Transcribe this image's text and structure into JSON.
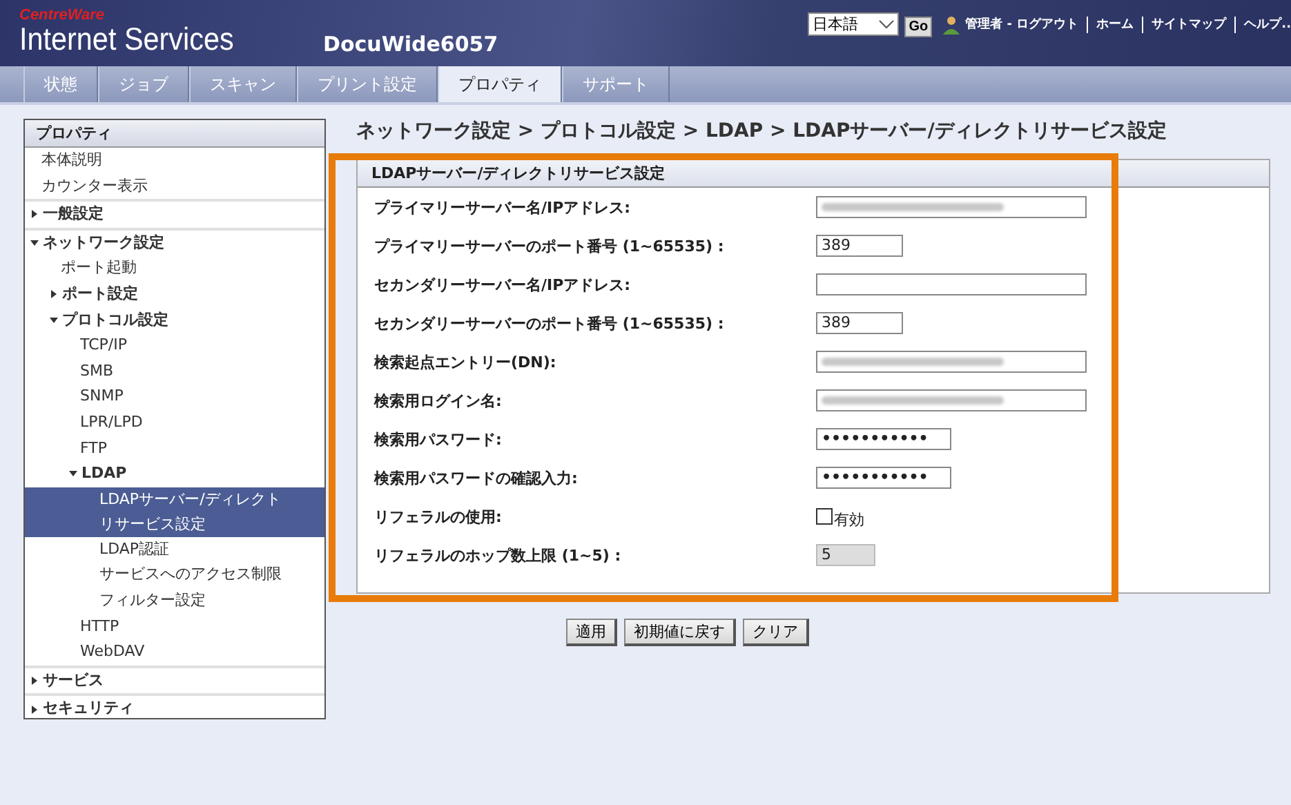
{
  "header": {
    "logo_top": "CentreWare",
    "logo_main": "Internet Services",
    "device": "DocuWide6057",
    "language": "日本語",
    "go": "Go",
    "user": "管理者 - ログアウト",
    "links": [
      "ホーム",
      "サイトマップ",
      "ヘルプ.."
    ]
  },
  "tabs": [
    {
      "label": "状態",
      "selected": false
    },
    {
      "label": "ジョブ",
      "selected": false
    },
    {
      "label": "スキャン",
      "selected": false
    },
    {
      "label": "プリント設定",
      "selected": false
    },
    {
      "label": "プロパティ",
      "selected": true
    },
    {
      "label": "サポート",
      "selected": false
    }
  ],
  "sidebar": {
    "title": "プロパティ",
    "items": [
      {
        "label": "本体説明",
        "selected": false
      },
      {
        "label": "カウンター表示",
        "selected": false
      },
      {
        "label": "一般設定",
        "selected": false,
        "expanded": false
      },
      {
        "label": "ネットワーク設定",
        "selected": false,
        "expanded": true,
        "children": [
          {
            "label": "ポート起動",
            "selected": false
          },
          {
            "label": "ポート設定",
            "selected": false,
            "expanded": false
          },
          {
            "label": "プロトコル設定",
            "selected": false,
            "expanded": true,
            "children": [
              {
                "label": "TCP/IP",
                "selected": false
              },
              {
                "label": "SMB",
                "selected": false
              },
              {
                "label": "SNMP",
                "selected": false
              },
              {
                "label": "LPR/LPD",
                "selected": false
              },
              {
                "label": "FTP",
                "selected": false
              },
              {
                "label": "LDAP",
                "selected": false,
                "expanded": true,
                "children": [
                  {
                    "label": "LDAPサーバー/ディレクトリサービス設定",
                    "selected": true
                  },
                  {
                    "label": "LDAP認証",
                    "selected": false
                  },
                  {
                    "label": "サービスへのアクセス制限",
                    "selected": false
                  },
                  {
                    "label": "フィルター設定",
                    "selected": false
                  }
                ]
              },
              {
                "label": "HTTP",
                "selected": false
              },
              {
                "label": "WebDAV",
                "selected": false
              }
            ]
          }
        ]
      },
      {
        "label": "サービス",
        "selected": false,
        "expanded": false
      },
      {
        "label": "セキュリティ",
        "selected": false,
        "expanded": false
      }
    ]
  },
  "breadcrumb": "ネットワーク設定 > プロトコル設定 > LDAP > LDAPサーバー/ディレクトリサービス設定",
  "panel": {
    "title": "LDAPサーバー/ディレクトリサービス設定",
    "highlighted": true,
    "fields": [
      {
        "label": "プライマリーサーバー名/IPアドレス:",
        "kind": "text",
        "redacted": true
      },
      {
        "label": "プライマリーサーバーのポート番号 (1~65535) :",
        "kind": "port",
        "value": "389"
      },
      {
        "label": "セカンダリーサーバー名/IPアドレス:",
        "kind": "text"
      },
      {
        "label": "セカンダリーサーバーのポート番号 (1~65535) :",
        "kind": "port",
        "value": "389"
      },
      {
        "label": "検索起点エントリー(DN):",
        "kind": "text",
        "redacted": true
      },
      {
        "label": "検索用ログイン名:",
        "kind": "text",
        "redacted": true
      },
      {
        "label": "検索用パスワード:",
        "kind": "password",
        "value": "•••••••••••"
      },
      {
        "label": "検索用パスワードの確認入力:",
        "kind": "password",
        "value": "•••••••••••"
      },
      {
        "label": "リフェラルの使用:",
        "kind": "checkbox",
        "checked": false,
        "value": "有効"
      },
      {
        "label": "リフェラルのホップ数上限 (1~5) :",
        "kind": "disabled",
        "value": "5"
      }
    ]
  },
  "buttons": [
    "適用",
    "初期値に戻す",
    "クリア"
  ]
}
